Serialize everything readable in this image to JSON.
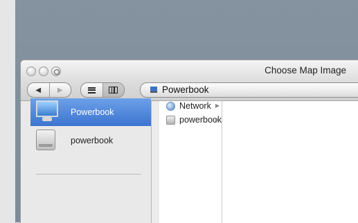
{
  "window": {
    "title": "Choose Map Image"
  },
  "toolbar": {
    "back_glyph": "◀",
    "forward_glyph": "▶",
    "location_label": "Powerbook"
  },
  "sidebar": {
    "items": [
      {
        "label": "Powerbook",
        "icon": "computer-icon",
        "selected": true
      },
      {
        "label": "powerbook",
        "icon": "hard-disk-icon",
        "selected": false
      }
    ]
  },
  "browser": {
    "column1": [
      {
        "label": "Network",
        "icon": "network-globe-icon"
      },
      {
        "label": "powerbook",
        "icon": "hard-disk-icon"
      }
    ],
    "arrow_glyph": "▶"
  },
  "colors": {
    "desktop": "#8593a1",
    "selection": "#3c74d0"
  }
}
